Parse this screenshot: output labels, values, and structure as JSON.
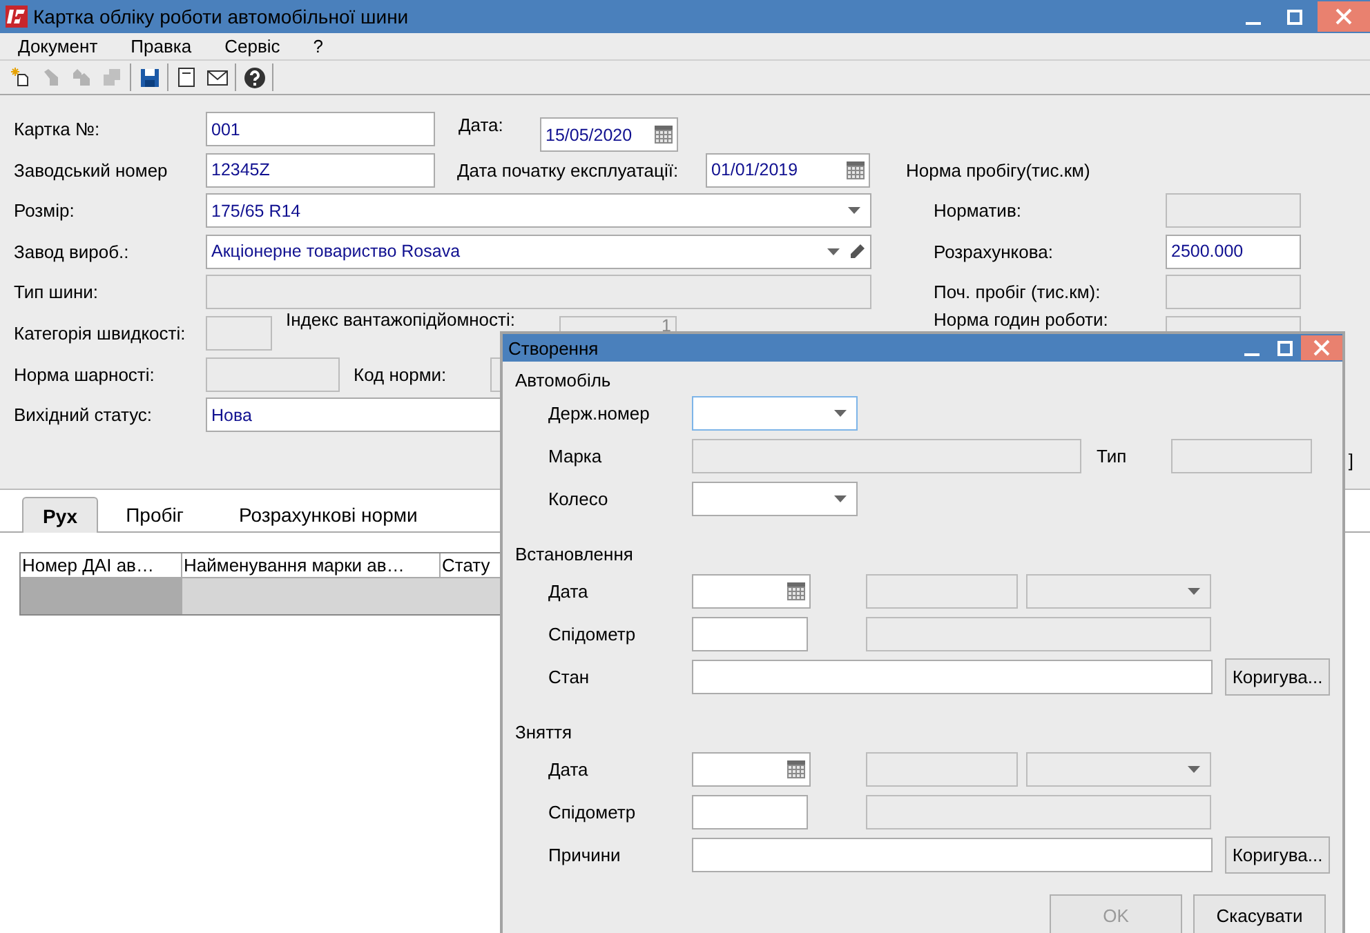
{
  "window": {
    "title": "Картка обліку роботи автомобільної шини"
  },
  "menu": [
    {
      "label": "Документ"
    },
    {
      "label": "Правка"
    },
    {
      "label": "Сервіс"
    },
    {
      "label": "?"
    }
  ],
  "toolbar": [
    {
      "kind": "new",
      "disabled": false
    },
    {
      "kind": "edit",
      "disabled": true
    },
    {
      "kind": "copy",
      "disabled": true
    },
    {
      "kind": "delete",
      "disabled": true
    },
    {
      "kind": "separator"
    },
    {
      "kind": "save",
      "disabled": false
    },
    {
      "kind": "separator"
    },
    {
      "kind": "properties",
      "disabled": false
    },
    {
      "kind": "mail",
      "disabled": false
    },
    {
      "kind": "separator"
    },
    {
      "kind": "help",
      "disabled": false
    },
    {
      "kind": "separator"
    }
  ],
  "form": {
    "card_number": {
      "label": "Картка №:",
      "value": "001"
    },
    "date": {
      "label": "Дата:",
      "value": "15/05/2020"
    },
    "factory_number": {
      "label": "Заводський номер",
      "value": "12345Z"
    },
    "start_date": {
      "label": "Дата початку експлуатації:",
      "value": "01/01/2019"
    },
    "size": {
      "label": "Розмір:",
      "value": "175/65 R14"
    },
    "manufacturer": {
      "label": "Завод вироб.:",
      "value": "Акціонерне товариство Rosava"
    },
    "tire_type": {
      "label": "Тип шини:"
    },
    "speed_category": {
      "label": "Категорія швидкості:"
    },
    "load_index": {
      "label": "Індекс вантажопідйомності:",
      "value": "1"
    },
    "ply_rating": {
      "label": "Норма шарності:"
    },
    "norm_code": {
      "label": "Код норми:"
    },
    "initial_status": {
      "label": "Вихідний статус:",
      "value": "Нова"
    }
  },
  "mileage_norm": {
    "title": "Норма пробігу(тис.км)",
    "fields": [
      {
        "label": "Норматив:",
        "disabled": true
      },
      {
        "label": "Розрахункова:",
        "value": "2500.000",
        "disabled": false
      },
      {
        "label": "Поч. пробіг (тис.км):",
        "disabled": true
      },
      {
        "label": "Норма годин роботи:",
        "disabled": true
      }
    ]
  },
  "fragment": "]",
  "tabs": [
    {
      "label": "Рух",
      "selected": true
    },
    {
      "label": "Пробіг",
      "selected": false
    },
    {
      "label": "Розрахункові норми",
      "selected": false
    }
  ],
  "table": {
    "columns": [
      "Номер ДАІ ав…",
      "Найменування марки ав…",
      "Стату"
    ],
    "rows": [
      {
        "selected": true
      }
    ]
  },
  "dialog": {
    "title": "Створення",
    "sections": [
      {
        "title": "Автомобіль",
        "rows": [
          {
            "kind": "combo",
            "label": "Держ.номер",
            "focused": true
          },
          {
            "kind": "text_with_type",
            "label": "Марка",
            "sublabel": "Тип"
          },
          {
            "kind": "combo",
            "label": "Колесо",
            "focused": false
          }
        ]
      },
      {
        "title": "Встановлення",
        "rows": [
          {
            "kind": "date",
            "label": "Дата"
          },
          {
            "kind": "number",
            "label": "Спідометр"
          },
          {
            "kind": "memo",
            "label": "Стан",
            "button": "Коригува..."
          }
        ]
      },
      {
        "title": "Зняття",
        "rows": [
          {
            "kind": "date",
            "label": "Дата"
          },
          {
            "kind": "number",
            "label": "Спідометр"
          },
          {
            "kind": "memo",
            "label": "Причини",
            "button": "Коригува..."
          }
        ]
      }
    ],
    "buttons": [
      {
        "label": "OK",
        "disabled": true
      },
      {
        "label": "Скасувати",
        "disabled": false
      }
    ]
  }
}
